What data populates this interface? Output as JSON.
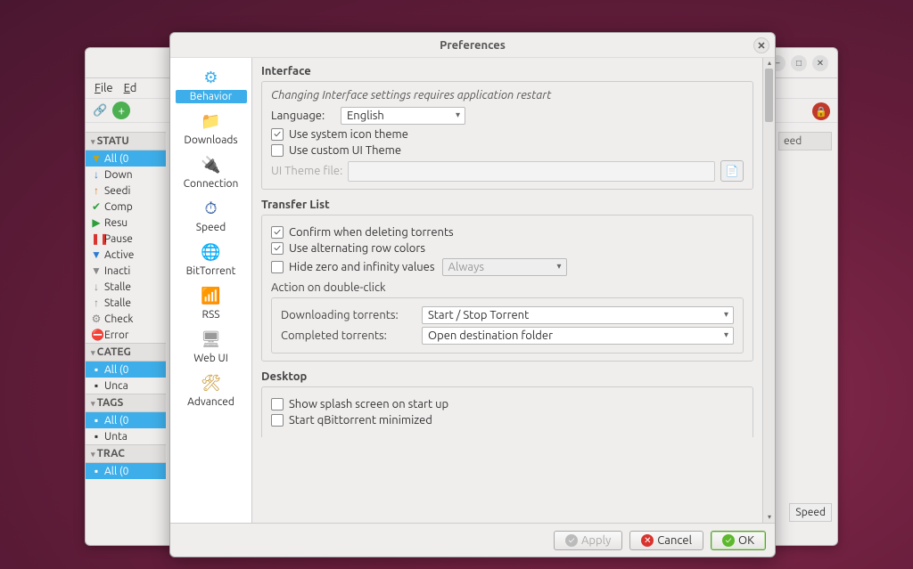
{
  "bg": {
    "menu": [
      "File",
      "Ed"
    ],
    "sections": {
      "status_hdr": "STATU",
      "categ_hdr": "CATEG",
      "tags_hdr": "TAGS",
      "track_hdr": "TRAC"
    },
    "status_items": [
      {
        "icon": "▼",
        "cls": "c-yel",
        "label": "All (0"
      },
      {
        "icon": "↓",
        "cls": "c-blue",
        "label": "Down"
      },
      {
        "icon": "↑",
        "cls": "c-orange",
        "label": "Seedi"
      },
      {
        "icon": "✔",
        "cls": "c-green",
        "label": "Comp"
      },
      {
        "icon": "▶",
        "cls": "c-green",
        "label": "Resu"
      },
      {
        "icon": "❚❚",
        "cls": "c-red",
        "label": "Pause"
      },
      {
        "icon": "▼",
        "cls": "c-blue",
        "label": "Active"
      },
      {
        "icon": "▼",
        "cls": "c-gray",
        "label": "Inacti"
      },
      {
        "icon": "↓",
        "cls": "c-gray",
        "label": "Stalle"
      },
      {
        "icon": "↑",
        "cls": "c-gray",
        "label": "Stalle"
      },
      {
        "icon": "⚙",
        "cls": "c-gray",
        "label": "Check"
      },
      {
        "icon": "⛔",
        "cls": "c-red",
        "label": "Error"
      }
    ],
    "categ_items": [
      {
        "label": "All (0"
      },
      {
        "label": "Unca"
      }
    ],
    "tags_items": [
      {
        "label": "All (0"
      },
      {
        "label": "Unta"
      }
    ],
    "track_items": [
      {
        "label": "All (0"
      }
    ],
    "col_header": "eed",
    "bottom_btn": "Speed"
  },
  "dialog": {
    "title": "Preferences",
    "categories": [
      {
        "name": "behavior",
        "label": "Behavior",
        "icon": "⚙",
        "color": "#3daee9"
      },
      {
        "name": "downloads",
        "label": "Downloads",
        "icon": "📁",
        "color": "#b33939"
      },
      {
        "name": "connection",
        "label": "Connection",
        "icon": "🔌",
        "color": "#888"
      },
      {
        "name": "speed",
        "label": "Speed",
        "icon": "⏱",
        "color": "#2c5aa0"
      },
      {
        "name": "bittorrent",
        "label": "BitTorrent",
        "icon": "🌐",
        "color": "#7b5acb"
      },
      {
        "name": "rss",
        "label": "RSS",
        "icon": "📶",
        "color": "#f6872a"
      },
      {
        "name": "webui",
        "label": "Web UI",
        "icon": "🖥",
        "color": "#999"
      },
      {
        "name": "advanced",
        "label": "Advanced",
        "icon": "🛠",
        "color": "#c6922a"
      }
    ],
    "active_category": "behavior",
    "interface": {
      "title": "Interface",
      "hint": "Changing Interface settings requires application restart",
      "language_label": "Language:",
      "language_value": "English",
      "use_system_icon_theme": "Use system icon theme",
      "use_custom_theme": "Use custom UI Theme",
      "ui_theme_file_label": "UI Theme file:"
    },
    "transfer": {
      "title": "Transfer List",
      "confirm_delete": "Confirm when deleting torrents",
      "alt_rows": "Use alternating row colors",
      "hide_zero": "Hide zero and infinity values",
      "hide_zero_mode": "Always",
      "dbl_click_title": "Action on double-click",
      "downloading_label": "Downloading torrents:",
      "downloading_value": "Start / Stop Torrent",
      "completed_label": "Completed torrents:",
      "completed_value": "Open destination folder"
    },
    "desktop": {
      "title": "Desktop",
      "splash": "Show splash screen on start up",
      "minimized": "Start qBittorrent minimized"
    },
    "buttons": {
      "apply": "Apply",
      "cancel": "Cancel",
      "ok": "OK"
    }
  }
}
